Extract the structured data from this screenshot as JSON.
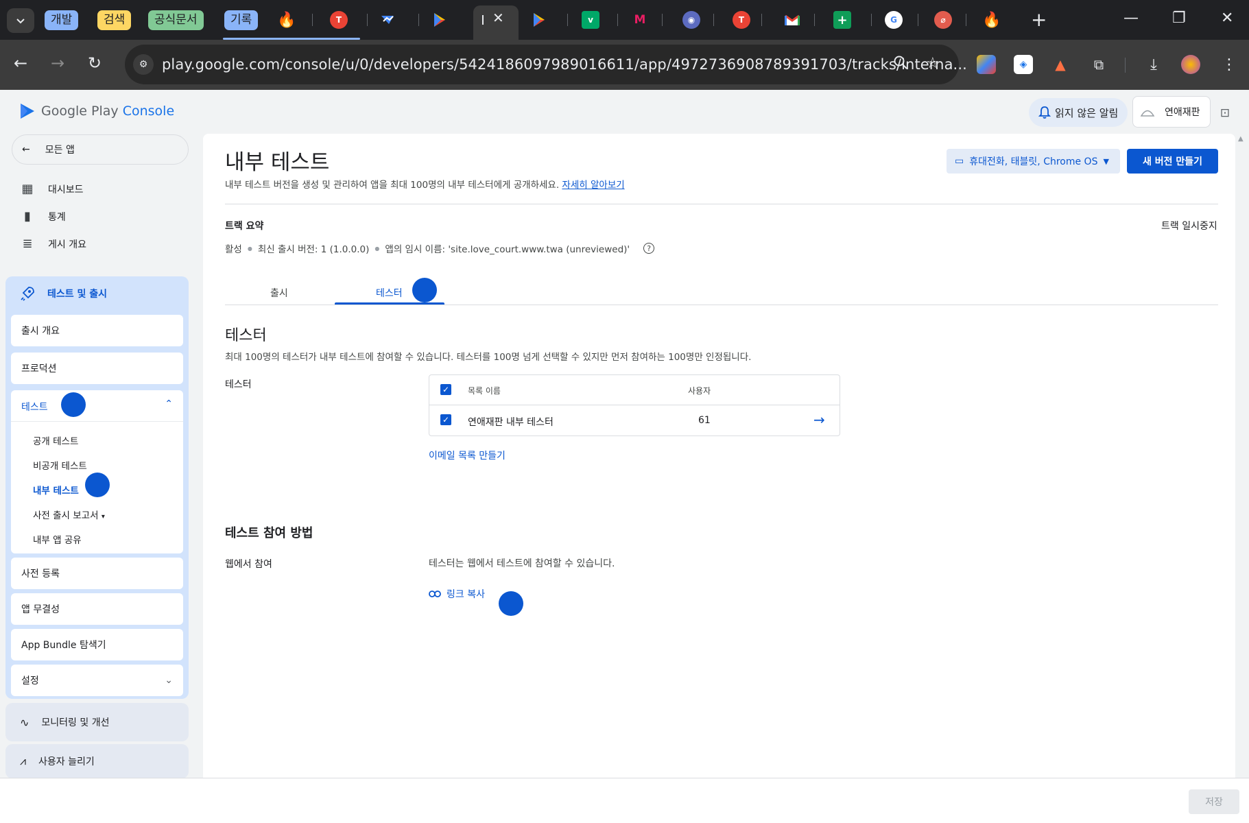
{
  "browser": {
    "tab_groups": [
      {
        "label": "개발",
        "color": "#8ab4f8"
      },
      {
        "label": "검색",
        "color": "#fdd663"
      },
      {
        "label": "공식문서",
        "color": "#81c995"
      },
      {
        "label": "기록",
        "color": "#8ab4f8"
      }
    ],
    "url": "play.google.com/console/u/0/developers/5424186097989016611/app/4972736908789391703/tracks/interna..."
  },
  "header": {
    "logo_text": "Google Play",
    "logo_accent": "Console",
    "notifications_label": "읽지 않은 알림",
    "app_name": "연애재판"
  },
  "sidebar": {
    "back_label": "모든 앱",
    "top_items": [
      {
        "label": "대시보드",
        "icon": "dashboard-icon"
      },
      {
        "label": "통계",
        "icon": "bar-chart-icon"
      },
      {
        "label": "게시 개요",
        "icon": "publishing-overview-icon"
      }
    ],
    "section_title": "테스트 및 출시",
    "section_items": {
      "release_overview": "출시 개요",
      "production": "프로덕션",
      "testing": "테스트",
      "testing_sub": [
        "공개 테스트",
        "비공개 테스트",
        "내부 테스트",
        "사전 출시 보고서",
        "내부 앱 공유"
      ],
      "pre_registration": "사전 등록",
      "app_integrity": "앱 무결성",
      "bundle_explorer": "App Bundle 탐색기",
      "settings": "설정"
    },
    "monitoring_label": "모니터링 및 개선",
    "grow_label": "사용자 늘리기"
  },
  "main": {
    "title": "내부 테스트",
    "subtitle": "내부 테스트 버전을 생성 및 관리하여 앱을 최대 100명의 내부 테스터에게 공개하세요.",
    "learn_more": "자세히 알아보기",
    "device_selector": "휴대전화, 태블릿, Chrome OS",
    "new_release_button": "새 버전 만들기",
    "summary_title": "트랙 요약",
    "pause_track": "트랙 일시중지",
    "status": "활성",
    "latest_release": "최신 출시 버전: 1 (1.0.0.0)",
    "temp_name": "앱의 임시 이름: 'site.love_court.www.twa (unreviewed)'",
    "tabs": [
      "출시",
      "테스터"
    ],
    "testers_heading": "테스터",
    "testers_desc": "최대 100명의 테스터가 내부 테스트에 참여할 수 있습니다. 테스터를 100명 넘게 선택할 수 있지만 먼저 참여하는 100명만 인정됩니다.",
    "testers_label": "테스터",
    "table": {
      "col_name": "목록 이름",
      "col_users": "사용자",
      "rows": [
        {
          "name": "연애재판 내부 테스터",
          "users": "61"
        }
      ]
    },
    "create_email_list": "이메일 목록 만들기",
    "join_heading": "테스트 참여 방법",
    "join_web_label": "웹에서 참여",
    "join_web_desc": "테스터는 웹에서 테스트에 참여할 수 있습니다.",
    "copy_link": "링크 복사"
  },
  "footer": {
    "save_label": "저장"
  }
}
